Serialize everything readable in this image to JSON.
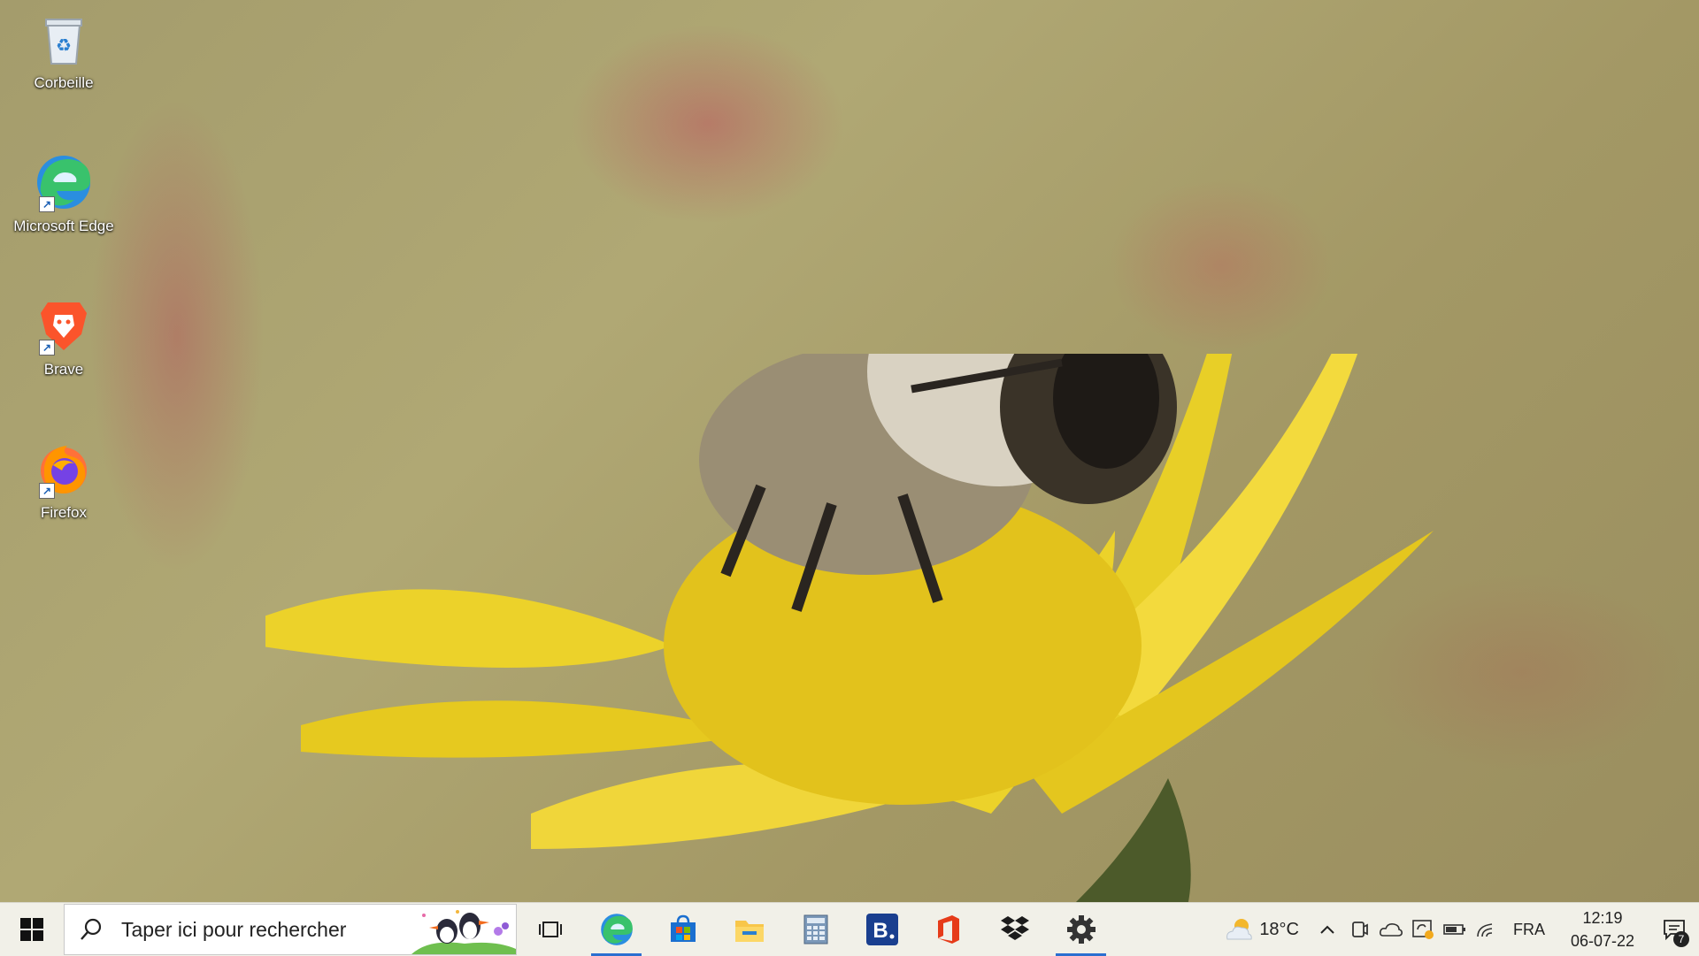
{
  "desktop": {
    "icons": [
      {
        "label": "Corbeille",
        "icon": "recycle-bin-icon"
      },
      {
        "label": "Microsoft Edge",
        "icon": "edge-icon"
      },
      {
        "label": "Brave",
        "icon": "brave-icon"
      },
      {
        "label": "Firefox",
        "icon": "firefox-icon"
      }
    ]
  },
  "taskbar": {
    "search": {
      "placeholder": "Taper ici pour rechercher"
    },
    "apps": [
      "task-view-icon",
      "edge-icon",
      "microsoft-store-icon",
      "file-explorer-icon",
      "calculator-icon",
      "b-app-icon",
      "office-icon",
      "dropbox-icon",
      "settings-icon"
    ],
    "active_apps": [
      "edge-icon",
      "settings-icon"
    ]
  },
  "tray": {
    "weather": {
      "temp": "18°C",
      "icon": "partly-cloudy-icon"
    },
    "language": "FRA",
    "time": "12:19",
    "date": "06-07-22",
    "notification_count": "7"
  }
}
